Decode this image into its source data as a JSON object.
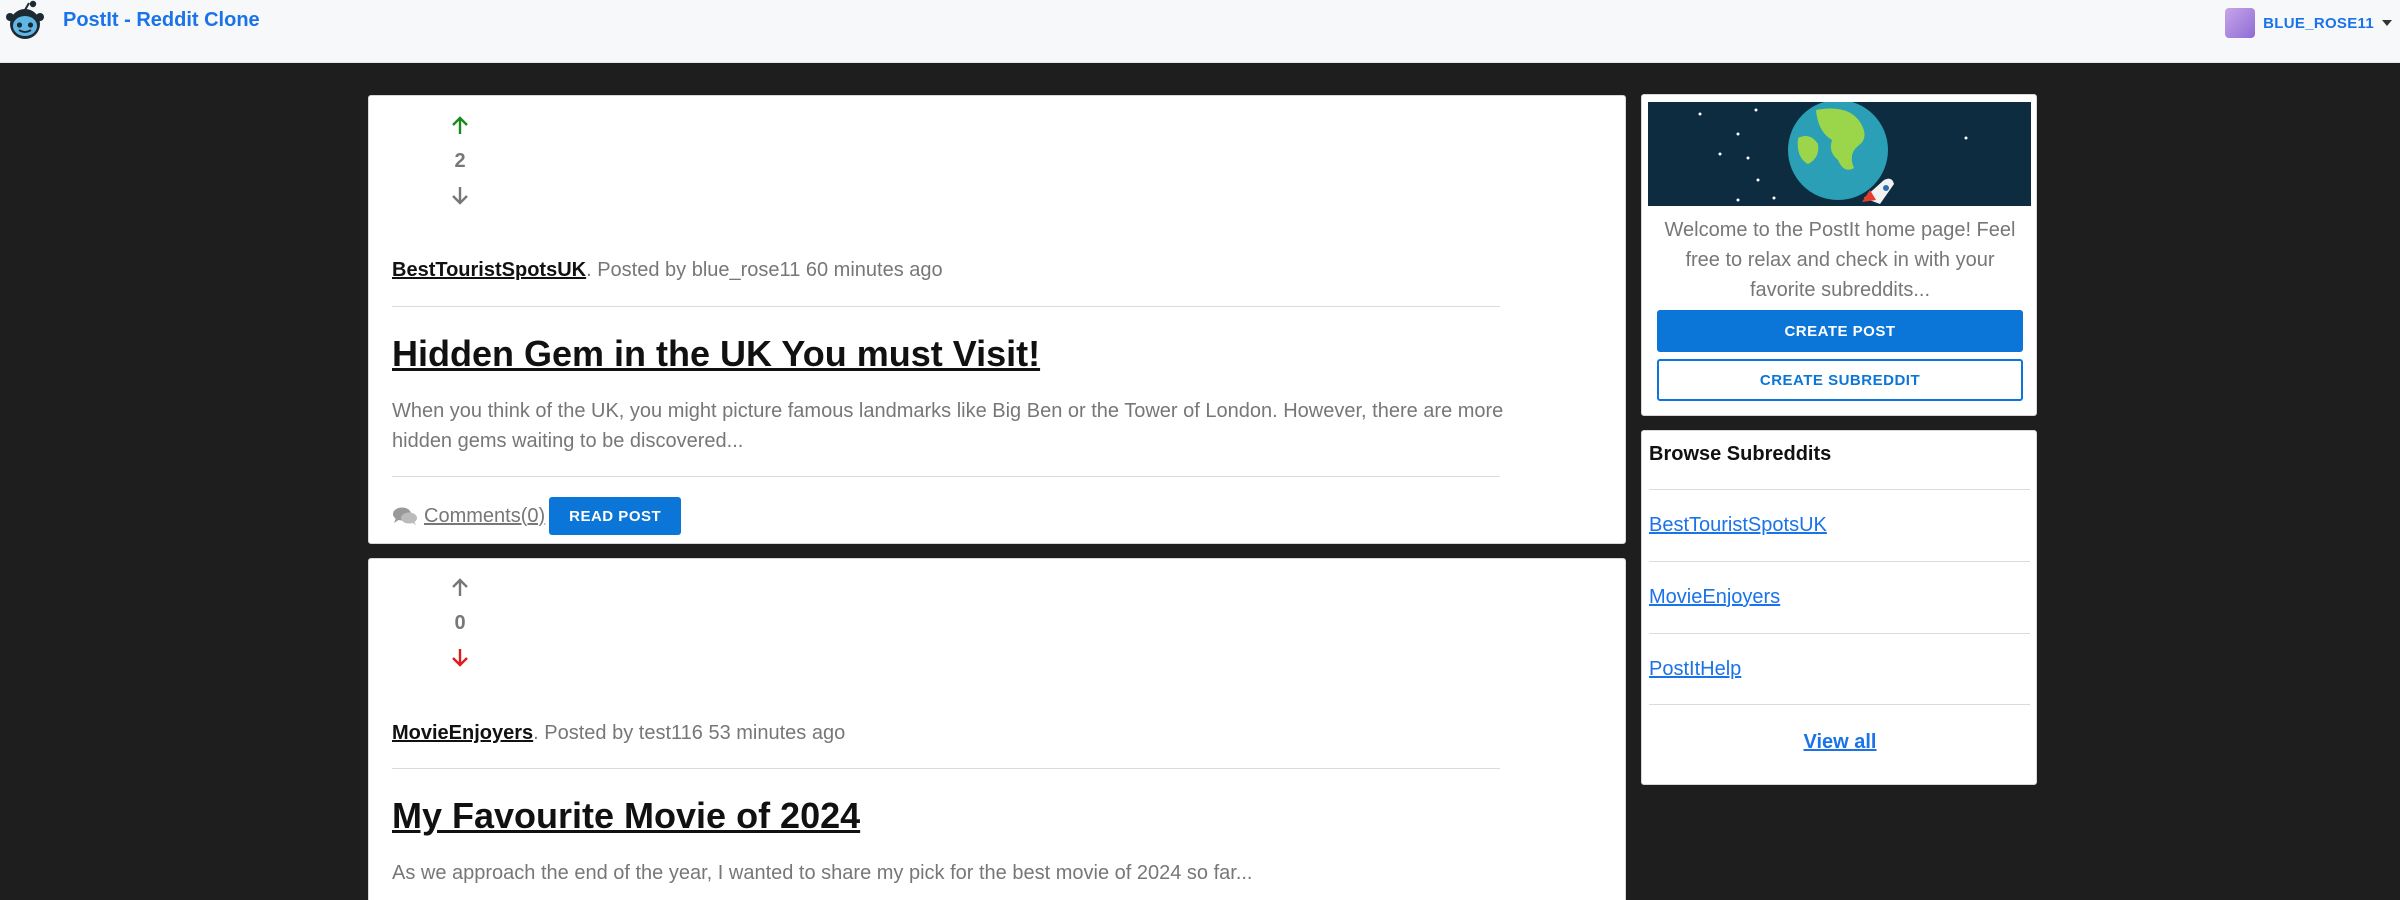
{
  "header": {
    "brand": "PostIt - Reddit Clone",
    "username": "BLUE_ROSE11",
    "logo_icon": "reddit-alien-icon",
    "avatar_icon": "user-avatar"
  },
  "colors": {
    "accent": "#0b76d8",
    "link": "#1a73e8",
    "upvote_active": "#1a8a1a",
    "downvote_active": "#e01b1b",
    "inactive": "#777777",
    "page_bg": "#1e1e1e"
  },
  "posts": [
    {
      "votes": "2",
      "vote_state": "up",
      "subreddit": "BestTouristSpotsUK",
      "byline": ". Posted by blue_rose11 60 minutes ago",
      "title": "Hidden Gem in the UK You must Visit!",
      "excerpt": "When you think of the UK, you might picture famous landmarks like Big Ben or the Tower of London. However, there are more hidden gems waiting to be discovered...",
      "comments_label": " Comments(0) ",
      "read_label": "READ POST"
    },
    {
      "votes": "0",
      "vote_state": "down",
      "subreddit": "MovieEnjoyers",
      "byline": ". Posted by test116 53 minutes ago",
      "title": "My Favourite Movie of 2024",
      "excerpt": "As we approach the end of the year, I wanted to share my pick for the best movie of 2024 so far..."
    }
  ],
  "sidebar": {
    "welcome_text": "Welcome to the PostIt home page! Feel free to relax and check in with your favorite subreddits...",
    "create_post_label": "CREATE POST",
    "create_subreddit_label": "CREATE SUBREDDIT",
    "browse_title": "Browse Subreddits",
    "subreddits": [
      "BestTouristSpotsUK",
      "MovieEnjoyers",
      "PostItHelp"
    ],
    "view_all_label": "View all"
  }
}
